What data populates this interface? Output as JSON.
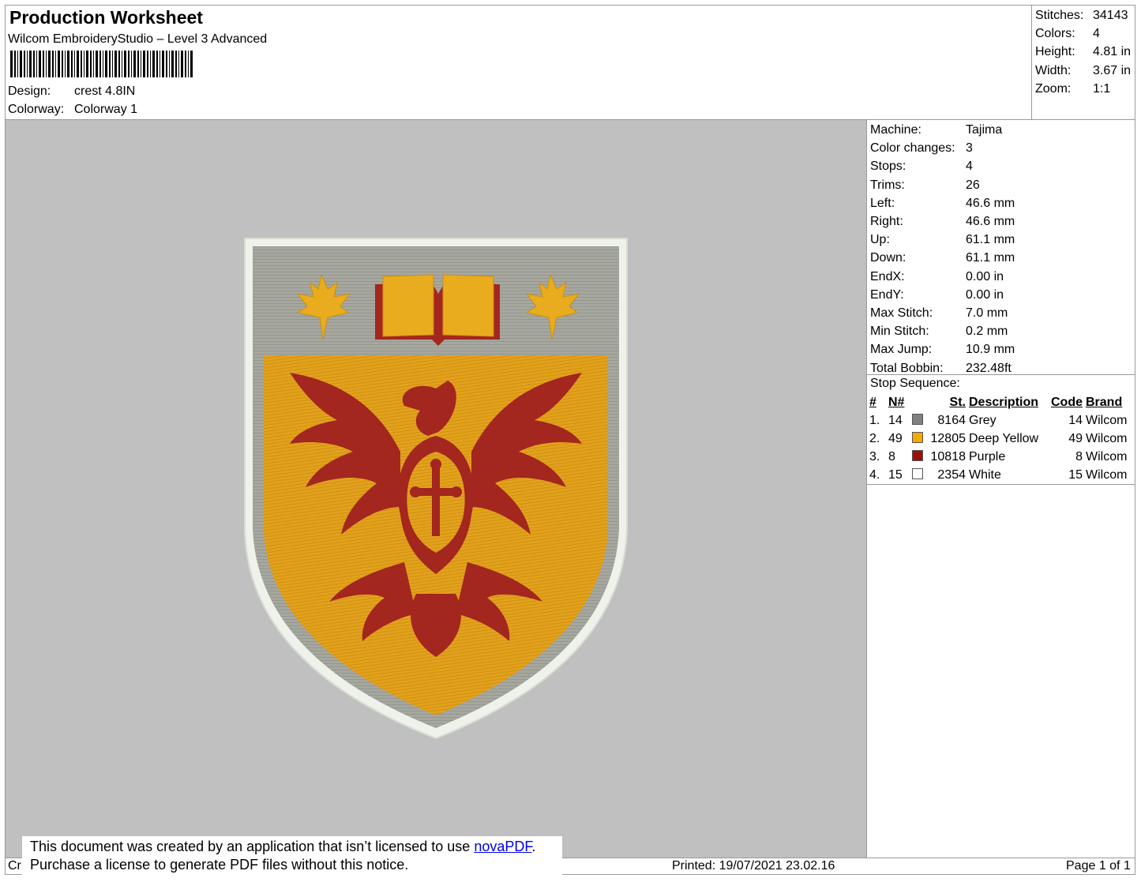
{
  "header": {
    "title": "Production Worksheet",
    "software": "Wilcom EmbroideryStudio – Level 3 Advanced",
    "design_label": "Design:",
    "design_value": "crest 4.8IN",
    "colorway_label": "Colorway:",
    "colorway_value": "Colorway 1"
  },
  "summary": [
    {
      "label": "Stitches:",
      "value": "34143"
    },
    {
      "label": "Colors:",
      "value": "4"
    },
    {
      "label": "Height:",
      "value": "4.81 in"
    },
    {
      "label": "Width:",
      "value": "3.67 in"
    },
    {
      "label": "Zoom:",
      "value": "1:1"
    }
  ],
  "machine_stats": [
    {
      "label": "Machine:",
      "value": "Tajima"
    },
    {
      "label": "Color changes:",
      "value": "3"
    },
    {
      "label": "Stops:",
      "value": "4"
    },
    {
      "label": "Trims:",
      "value": "26"
    },
    {
      "label": "Left:",
      "value": "46.6 mm"
    },
    {
      "label": "Right:",
      "value": "46.6 mm"
    },
    {
      "label": "Up:",
      "value": "61.1 mm"
    },
    {
      "label": "Down:",
      "value": "61.1 mm"
    },
    {
      "label": "EndX:",
      "value": "0.00 in"
    },
    {
      "label": "EndY:",
      "value": "0.00 in"
    },
    {
      "label": "Max Stitch:",
      "value": "7.0 mm"
    },
    {
      "label": "Min Stitch:",
      "value": "0.2 mm"
    },
    {
      "label": "Max Jump:",
      "value": "10.9 mm"
    },
    {
      "label": "Total Bobbin:",
      "value": "232.48ft"
    }
  ],
  "stop_sequence": {
    "title": "Stop Sequence:",
    "columns": {
      "num": "#",
      "needle": "N#",
      "stitches": "St.",
      "description": "Description",
      "code": "Code",
      "brand": "Brand"
    },
    "rows": [
      {
        "num": "1.",
        "needle": "14",
        "color": "#808080",
        "stitches": "8164",
        "description": "Grey",
        "code": "14",
        "brand": "Wilcom"
      },
      {
        "num": "2.",
        "needle": "49",
        "color": "#f5a800",
        "stitches": "12805",
        "description": "Deep Yellow",
        "code": "49",
        "brand": "Wilcom"
      },
      {
        "num": "3.",
        "needle": "8",
        "color": "#9b0f0f",
        "stitches": "10818",
        "description": "Purple",
        "code": "8",
        "brand": "Wilcom"
      },
      {
        "num": "4.",
        "needle": "15",
        "color": "#ffffff",
        "stitches": "2354",
        "description": "White",
        "code": "15",
        "brand": "Wilcom"
      }
    ]
  },
  "footer": {
    "left_fragment": "Cr",
    "notice_line1": "This document was created by an application that isn’t licensed to use ",
    "notice_link": "novaPDF",
    "notice_period": ".",
    "notice_line2": "Purchase a license to generate PDF files without this notice.",
    "printed": "Printed: 19/07/2021 23.02.16",
    "page": "Page 1 of 1"
  },
  "colors": {
    "preview_background": "#c0c0c0",
    "border_grey": "#9a9a9a",
    "thread_grey": "#a6a8a0",
    "thread_yellow": "#e3a21c",
    "thread_red": "#a3261f",
    "thread_white": "#eef2ea"
  }
}
